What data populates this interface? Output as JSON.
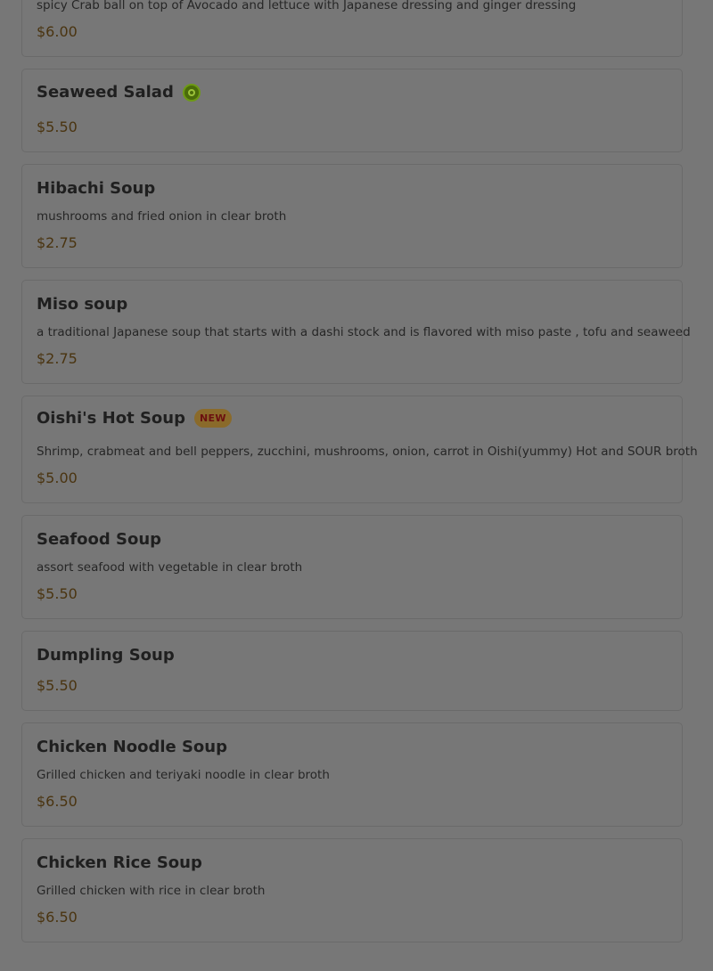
{
  "items": [
    {
      "name": "",
      "desc": "spicy Crab ball on top of Avocado and lettuce with Japanese dressing and ginger dressing",
      "price": "$6.00"
    },
    {
      "name": "Seaweed Salad",
      "icon": "vegetarian-icon",
      "price": "$5.50"
    },
    {
      "name": "Hibachi Soup",
      "desc": "mushrooms and fried onion in clear broth",
      "price": "$2.75"
    },
    {
      "name": "Miso soup",
      "desc": "a traditional Japanese soup that starts with a dashi stock and is flavored with miso paste , tofu and seaweed",
      "price": "$2.75"
    },
    {
      "name": "Oishi's Hot Soup",
      "badge": "NEW",
      "desc": "Shrimp, crabmeat and bell peppers, zucchini, mushrooms, onion, carrot in Oishi(yummy) Hot and SOUR broth",
      "price": "$5.00"
    },
    {
      "name": "Seafood Soup",
      "desc": "assort seafood with vegetable in clear broth",
      "price": "$5.50"
    },
    {
      "name": "Dumpling Soup",
      "price": "$5.50"
    },
    {
      "name": "Chicken Noodle Soup",
      "desc": "Grilled chicken and teriyaki noodle in clear broth",
      "price": "$6.50"
    },
    {
      "name": "Chicken Rice Soup",
      "desc": "Grilled chicken with rice in clear broth",
      "price": "$6.50"
    }
  ]
}
